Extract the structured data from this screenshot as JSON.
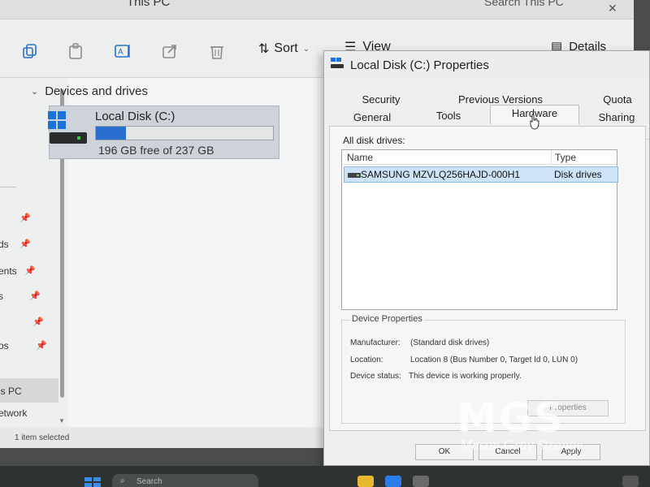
{
  "explorer": {
    "title": "This PC",
    "search_placeholder": "Search This PC",
    "toolbar": {
      "sort_label": "Sort",
      "view_label": "View",
      "details_label": "Details"
    },
    "nav": {
      "items": [
        "ds",
        "ents",
        "s",
        "os"
      ],
      "this_pc": "is PC",
      "network": "etwork"
    },
    "group_header": "Devices and drives",
    "drive": {
      "name": "Local Disk (C:)",
      "free_text": "196 GB free of 237 GB",
      "used_fraction": 0.17
    },
    "status": "1 item selected"
  },
  "dialog": {
    "title": "Local Disk (C:) Properties",
    "tabs_row1": [
      "Security",
      "Previous Versions",
      "Quota"
    ],
    "tabs_row2": [
      "General",
      "Tools",
      "Hardware",
      "Sharing"
    ],
    "active_tab": "Hardware",
    "all_disk_drives_label": "All disk drives:",
    "columns": [
      "Name",
      "Type"
    ],
    "rows": [
      {
        "name": "SAMSUNG MZVLQ256HAJD-000H1",
        "type": "Disk drives"
      }
    ],
    "device_properties": {
      "title": "Device Properties",
      "manufacturer_label": "Manufacturer:",
      "manufacturer": "(Standard disk drives)",
      "location_label": "Location:",
      "location": "Location 8 (Bus Number 0, Target Id 0, LUN 0)",
      "status_label": "Device status:",
      "status": "This device is working properly.",
      "properties_button": "Properties"
    },
    "buttons": {
      "ok": "OK",
      "cancel": "Cancel",
      "apply": "Apply"
    }
  },
  "watermark": {
    "letters": "MGS",
    "name": "Mason Gray Strange"
  },
  "taskbar": {
    "search_text": "Search"
  },
  "colors": {
    "accent": "#2a6fcf",
    "selection": "#cde3f7",
    "windows_blue": "#1a73d9"
  }
}
